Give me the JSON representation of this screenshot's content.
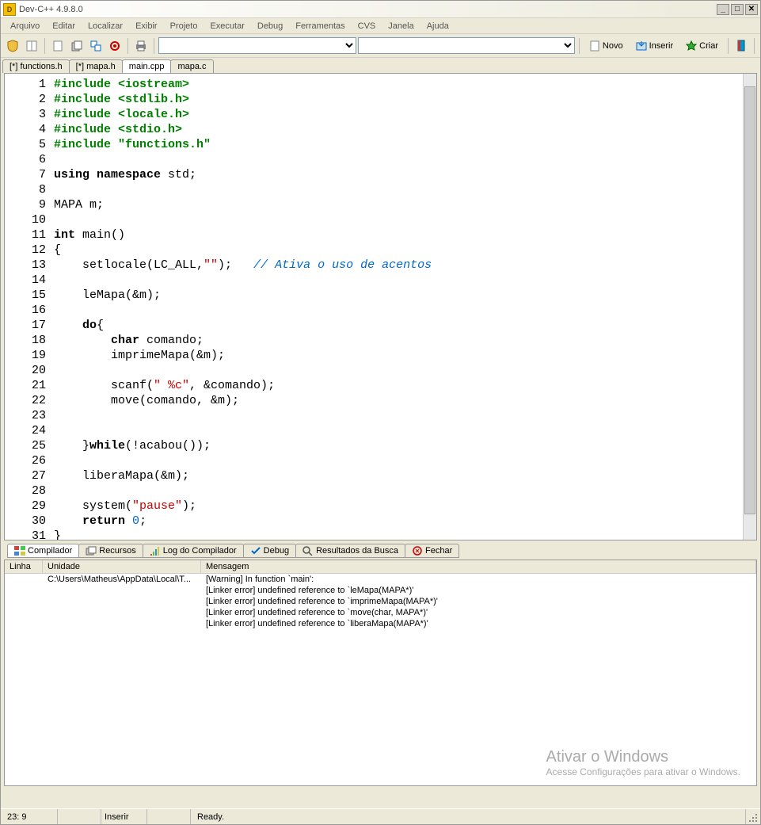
{
  "titlebar": {
    "title": "Dev-C++ 4.9.8.0"
  },
  "menubar": [
    "Arquivo",
    "Editar",
    "Localizar",
    "Exibir",
    "Projeto",
    "Executar",
    "Debug",
    "Ferramentas",
    "CVS",
    "Janela",
    "Ajuda"
  ],
  "toolbar": {
    "novo": "Novo",
    "inserir": "Inserir",
    "criar": "Criar"
  },
  "tabs": [
    {
      "label": "[*] functions.h",
      "active": false
    },
    {
      "label": "[*] mapa.h",
      "active": false
    },
    {
      "label": "main.cpp",
      "active": true
    },
    {
      "label": "mapa.c",
      "active": false
    }
  ],
  "code_lines": 31,
  "code": [
    {
      "n": 1,
      "seg": [
        {
          "c": "dir",
          "t": "#include "
        },
        {
          "c": "dir",
          "t": "<iostream>"
        }
      ]
    },
    {
      "n": 2,
      "seg": [
        {
          "c": "dir",
          "t": "#include "
        },
        {
          "c": "dir",
          "t": "<stdlib.h>"
        }
      ]
    },
    {
      "n": 3,
      "seg": [
        {
          "c": "dir",
          "t": "#include "
        },
        {
          "c": "dir",
          "t": "<locale.h>"
        }
      ]
    },
    {
      "n": 4,
      "seg": [
        {
          "c": "dir",
          "t": "#include "
        },
        {
          "c": "dir",
          "t": "<stdio.h>"
        }
      ]
    },
    {
      "n": 5,
      "seg": [
        {
          "c": "dir",
          "t": "#include "
        },
        {
          "c": "dir",
          "t": "\"functions.h\""
        }
      ]
    },
    {
      "n": 6,
      "seg": []
    },
    {
      "n": 7,
      "seg": [
        {
          "c": "kw",
          "t": "using namespace"
        },
        {
          "c": "",
          "t": " std;"
        }
      ]
    },
    {
      "n": 8,
      "seg": []
    },
    {
      "n": 9,
      "seg": [
        {
          "c": "",
          "t": "MAPA m;"
        }
      ]
    },
    {
      "n": 10,
      "seg": []
    },
    {
      "n": 11,
      "seg": [
        {
          "c": "kw",
          "t": "int"
        },
        {
          "c": "",
          "t": " main()"
        }
      ]
    },
    {
      "n": 12,
      "seg": [
        {
          "c": "",
          "t": "{"
        }
      ]
    },
    {
      "n": 13,
      "seg": [
        {
          "c": "",
          "t": "    setlocale(LC_ALL,"
        },
        {
          "c": "str",
          "t": "\"\""
        },
        {
          "c": "",
          "t": ");   "
        },
        {
          "c": "cmt",
          "t": "// Ativa o uso de acentos"
        }
      ]
    },
    {
      "n": 14,
      "seg": []
    },
    {
      "n": 15,
      "seg": [
        {
          "c": "",
          "t": "    leMapa(&m);"
        }
      ]
    },
    {
      "n": 16,
      "seg": []
    },
    {
      "n": 17,
      "seg": [
        {
          "c": "",
          "t": "    "
        },
        {
          "c": "kw",
          "t": "do"
        },
        {
          "c": "",
          "t": "{"
        }
      ]
    },
    {
      "n": 18,
      "seg": [
        {
          "c": "",
          "t": "        "
        },
        {
          "c": "kw",
          "t": "char"
        },
        {
          "c": "",
          "t": " comando;"
        }
      ]
    },
    {
      "n": 19,
      "seg": [
        {
          "c": "",
          "t": "        imprimeMapa(&m);"
        }
      ]
    },
    {
      "n": 20,
      "seg": []
    },
    {
      "n": 21,
      "seg": [
        {
          "c": "",
          "t": "        scanf("
        },
        {
          "c": "str",
          "t": "\" %c\""
        },
        {
          "c": "",
          "t": ", &comando);"
        }
      ]
    },
    {
      "n": 22,
      "seg": [
        {
          "c": "",
          "t": "        move(comando, &m);"
        }
      ]
    },
    {
      "n": 23,
      "seg": []
    },
    {
      "n": 24,
      "seg": []
    },
    {
      "n": 25,
      "seg": [
        {
          "c": "",
          "t": "    }"
        },
        {
          "c": "kw",
          "t": "while"
        },
        {
          "c": "",
          "t": "(!acabou());"
        }
      ]
    },
    {
      "n": 26,
      "seg": []
    },
    {
      "n": 27,
      "seg": [
        {
          "c": "",
          "t": "    liberaMapa(&m);"
        }
      ]
    },
    {
      "n": 28,
      "seg": []
    },
    {
      "n": 29,
      "seg": [
        {
          "c": "",
          "t": "    system("
        },
        {
          "c": "str",
          "t": "\"pause\""
        },
        {
          "c": "",
          "t": ");"
        }
      ]
    },
    {
      "n": 30,
      "seg": [
        {
          "c": "",
          "t": "    "
        },
        {
          "c": "kw",
          "t": "return"
        },
        {
          "c": "",
          "t": " "
        },
        {
          "c": "num",
          "t": "0"
        },
        {
          "c": "",
          "t": ";"
        }
      ]
    },
    {
      "n": 31,
      "seg": [
        {
          "c": "",
          "t": "}"
        }
      ]
    }
  ],
  "bottom_tabs": [
    {
      "label": "Compilador",
      "active": true
    },
    {
      "label": "Recursos",
      "active": false
    },
    {
      "label": "Log do Compilador",
      "active": false
    },
    {
      "label": "Debug",
      "active": false
    },
    {
      "label": "Resultados da Busca",
      "active": false
    },
    {
      "label": "Fechar",
      "active": false
    }
  ],
  "compiler": {
    "columns": {
      "linha": "Linha",
      "unidade": "Unidade",
      "mensagem": "Mensagem"
    },
    "rows": [
      {
        "linha": "",
        "unidade": "C:\\Users\\Matheus\\AppData\\Local\\T...",
        "msg": "[Warning] In function `main':"
      },
      {
        "linha": "",
        "unidade": "",
        "msg": "[Linker error] undefined reference to `leMapa(MAPA*)'"
      },
      {
        "linha": "",
        "unidade": "",
        "msg": "[Linker error] undefined reference to `imprimeMapa(MAPA*)'"
      },
      {
        "linha": "",
        "unidade": "",
        "msg": "[Linker error] undefined reference to `move(char, MAPA*)'"
      },
      {
        "linha": "",
        "unidade": "",
        "msg": "[Linker error] undefined reference to `liberaMapa(MAPA*)'"
      }
    ]
  },
  "watermark": {
    "line1": "Ativar o Windows",
    "line2": "Acesse Configurações para ativar o Windows."
  },
  "statusbar": {
    "pos": "23: 9",
    "mode": "Inserir",
    "ready": "Ready."
  }
}
